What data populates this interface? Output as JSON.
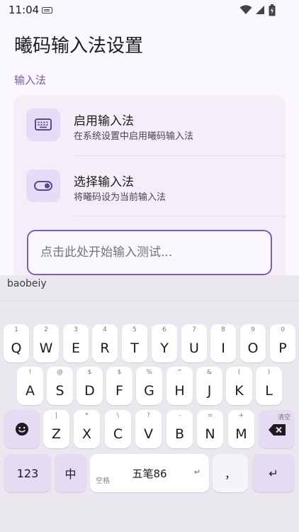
{
  "status": {
    "time": "11:04"
  },
  "app": {
    "title": "曦码输入法设置",
    "section": "输入法",
    "rows": [
      {
        "title": "启用输入法",
        "subtitle": "在系统设置中启用曦码输入法",
        "icon": "keyboard-icon"
      },
      {
        "title": "选择输入法",
        "subtitle": "将曦码设为当前输入法",
        "icon": "toggle-icon"
      }
    ],
    "test_input": {
      "placeholder": "点击此处开始输入测试...",
      "value": ""
    }
  },
  "keyboard": {
    "candidate": "baobeiy",
    "row1": [
      {
        "k": "Q",
        "h": "1"
      },
      {
        "k": "W",
        "h": "2"
      },
      {
        "k": "E",
        "h": "3"
      },
      {
        "k": "R",
        "h": "4"
      },
      {
        "k": "T",
        "h": "5"
      },
      {
        "k": "Y",
        "h": "6"
      },
      {
        "k": "U",
        "h": "7"
      },
      {
        "k": "I",
        "h": "8"
      },
      {
        "k": "O",
        "h": "9"
      },
      {
        "k": "P",
        "h": "0"
      }
    ],
    "row2": [
      {
        "k": "A",
        "h": "!"
      },
      {
        "k": "S",
        "h": "@"
      },
      {
        "k": "D",
        "h": "$"
      },
      {
        "k": "F",
        "h": "$"
      },
      {
        "k": "G",
        "h": "%"
      },
      {
        "k": "H",
        "h": "^"
      },
      {
        "k": "J",
        "h": "&"
      },
      {
        "k": "K",
        "h": "("
      },
      {
        "k": "L",
        "h": ")"
      }
    ],
    "row3": [
      {
        "k": "Z",
        "h": "|"
      },
      {
        "k": "X",
        "h": "*"
      },
      {
        "k": "C",
        "h": "\\"
      },
      {
        "k": "V",
        "h": "?"
      },
      {
        "k": "B",
        "h": "-"
      },
      {
        "k": "N",
        "h": "="
      },
      {
        "k": "M",
        "h": "+"
      }
    ],
    "delete_hint": "清空",
    "num_label": "123",
    "lang_label": "中",
    "space_sub": "空格",
    "space_main": "五笔86",
    "space_corner": "↵",
    "punct_label": "，",
    "enter_label": "↵"
  }
}
